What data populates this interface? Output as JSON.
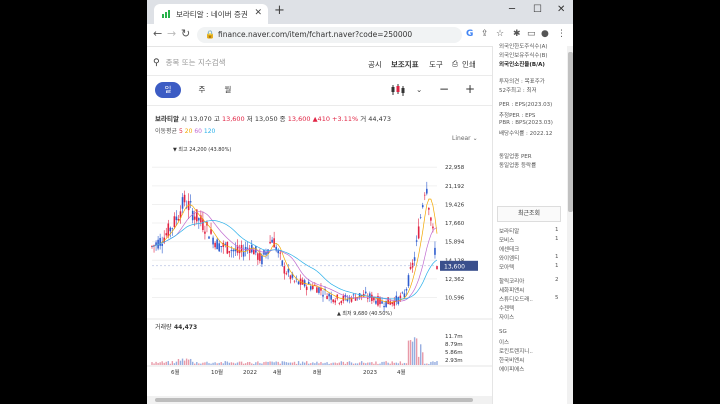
{
  "browser": {
    "tab_title": "보라티알 : 네이버 증권",
    "url": "finance.naver.com/item/fchart.naver?code=250000",
    "newtab_label": "+",
    "controls": {
      "minimize": "─",
      "maximize": "☐",
      "close": "✕"
    }
  },
  "toolbar": {
    "search_placeholder": "종목 또는 지수검색",
    "gongsi": "공시",
    "indicators": "보조지표",
    "tools": "도구",
    "print": "인쇄"
  },
  "periods": [
    "일",
    "주",
    "월"
  ],
  "stock": {
    "name": "보라티알",
    "open_label": "시",
    "open": "13,070",
    "high_label": "고",
    "high": "13,600",
    "low_label": "저",
    "low": "13,050",
    "close_label": "종",
    "close": "13,600",
    "change": "▲410",
    "change_pct": "+3.11%",
    "volume_label": "거",
    "volume": "44,473"
  },
  "ma": {
    "label": "이동평균",
    "periods": [
      "5",
      "20",
      "60",
      "120"
    ],
    "colors": [
      "#e12343",
      "#f2a800",
      "#c06bd0",
      "#2bb0ea"
    ]
  },
  "scale_mode": "Linear",
  "chart_data": {
    "type": "line",
    "title": "",
    "y_ticks": [
      "22,958",
      "21,192",
      "19,426",
      "17,660",
      "15,894",
      "14,128",
      "12,362",
      "10,596"
    ],
    "x_ticks": [
      "6월",
      "10월",
      "2022",
      "4월",
      "8월",
      "2023",
      "4월"
    ],
    "current_price_label": "13,600",
    "max_annotation": "최고 24,200 (43.80%)",
    "min_annotation": "최저 9,680 (40.50%)",
    "x": [
      "2021-05",
      "2021-06",
      "2021-07",
      "2021-08",
      "2021-09",
      "2021-10",
      "2021-11",
      "2021-12",
      "2022-01",
      "2022-02",
      "2022-03",
      "2022-04",
      "2022-05",
      "2022-06",
      "2022-07",
      "2022-08",
      "2022-09",
      "2022-10",
      "2022-11",
      "2022-12",
      "2023-01",
      "2023-02",
      "2023-03",
      "2023-04",
      "2023-05",
      "2023-06",
      "2023-07"
    ],
    "series": [
      {
        "values": [
          15400,
          16200,
          17600,
          19800,
          18300,
          17200,
          15600,
          15300,
          14800,
          15500,
          14100,
          16300,
          13400,
          12100,
          11800,
          11600,
          10900,
          10400,
          10500,
          10800,
          10600,
          10100,
          10200,
          10700,
          14500,
          21800,
          13600
        ]
      }
    ],
    "ylim": [
      9500,
      24500
    ],
    "volume_label": "거래량",
    "volume_value": "44,473",
    "volume_ticks": [
      "11.7m",
      "8.79m",
      "5.86m",
      "2.93m"
    ]
  },
  "sidebar": {
    "top_items": [
      "외국인한도주식수(A)",
      "외국인보유주식수(B)",
      "외국인소진율(B/A)"
    ],
    "invest_items": [
      "투자의견 : 목표주가",
      "52주최고 : 최저"
    ],
    "per_items": [
      "PER : EPS(2023.03)",
      "추정PER : EPS",
      "PBR : BPS(2023.03)",
      "배당수익률 : 2022.12"
    ],
    "industry_items": [
      "동일업종 PER",
      "동일업종 등락률"
    ],
    "recent_header": "최근조회",
    "recent": [
      {
        "name": "보라티알",
        "n": "1"
      },
      {
        "name": "모비스",
        "n": "1"
      },
      {
        "name": "에센테크",
        "n": ""
      },
      {
        "name": "와이엠티",
        "n": "1"
      },
      {
        "name": "모아텍",
        "n": "1"
      },
      {
        "name": "할릭코리아",
        "n": "2"
      },
      {
        "name": "세화피앤씨",
        "n": ""
      },
      {
        "name": "스튜디오드래..",
        "n": "5"
      },
      {
        "name": "수젠텍",
        "n": ""
      },
      {
        "name": "자이스",
        "n": ""
      },
      {
        "name": "SG",
        "n": ""
      },
      {
        "name": "이스",
        "n": ""
      },
      {
        "name": "로킨트렌지니..",
        "n": ""
      },
      {
        "name": "한국비엔씨",
        "n": ""
      },
      {
        "name": "에이피에스",
        "n": ""
      }
    ]
  }
}
